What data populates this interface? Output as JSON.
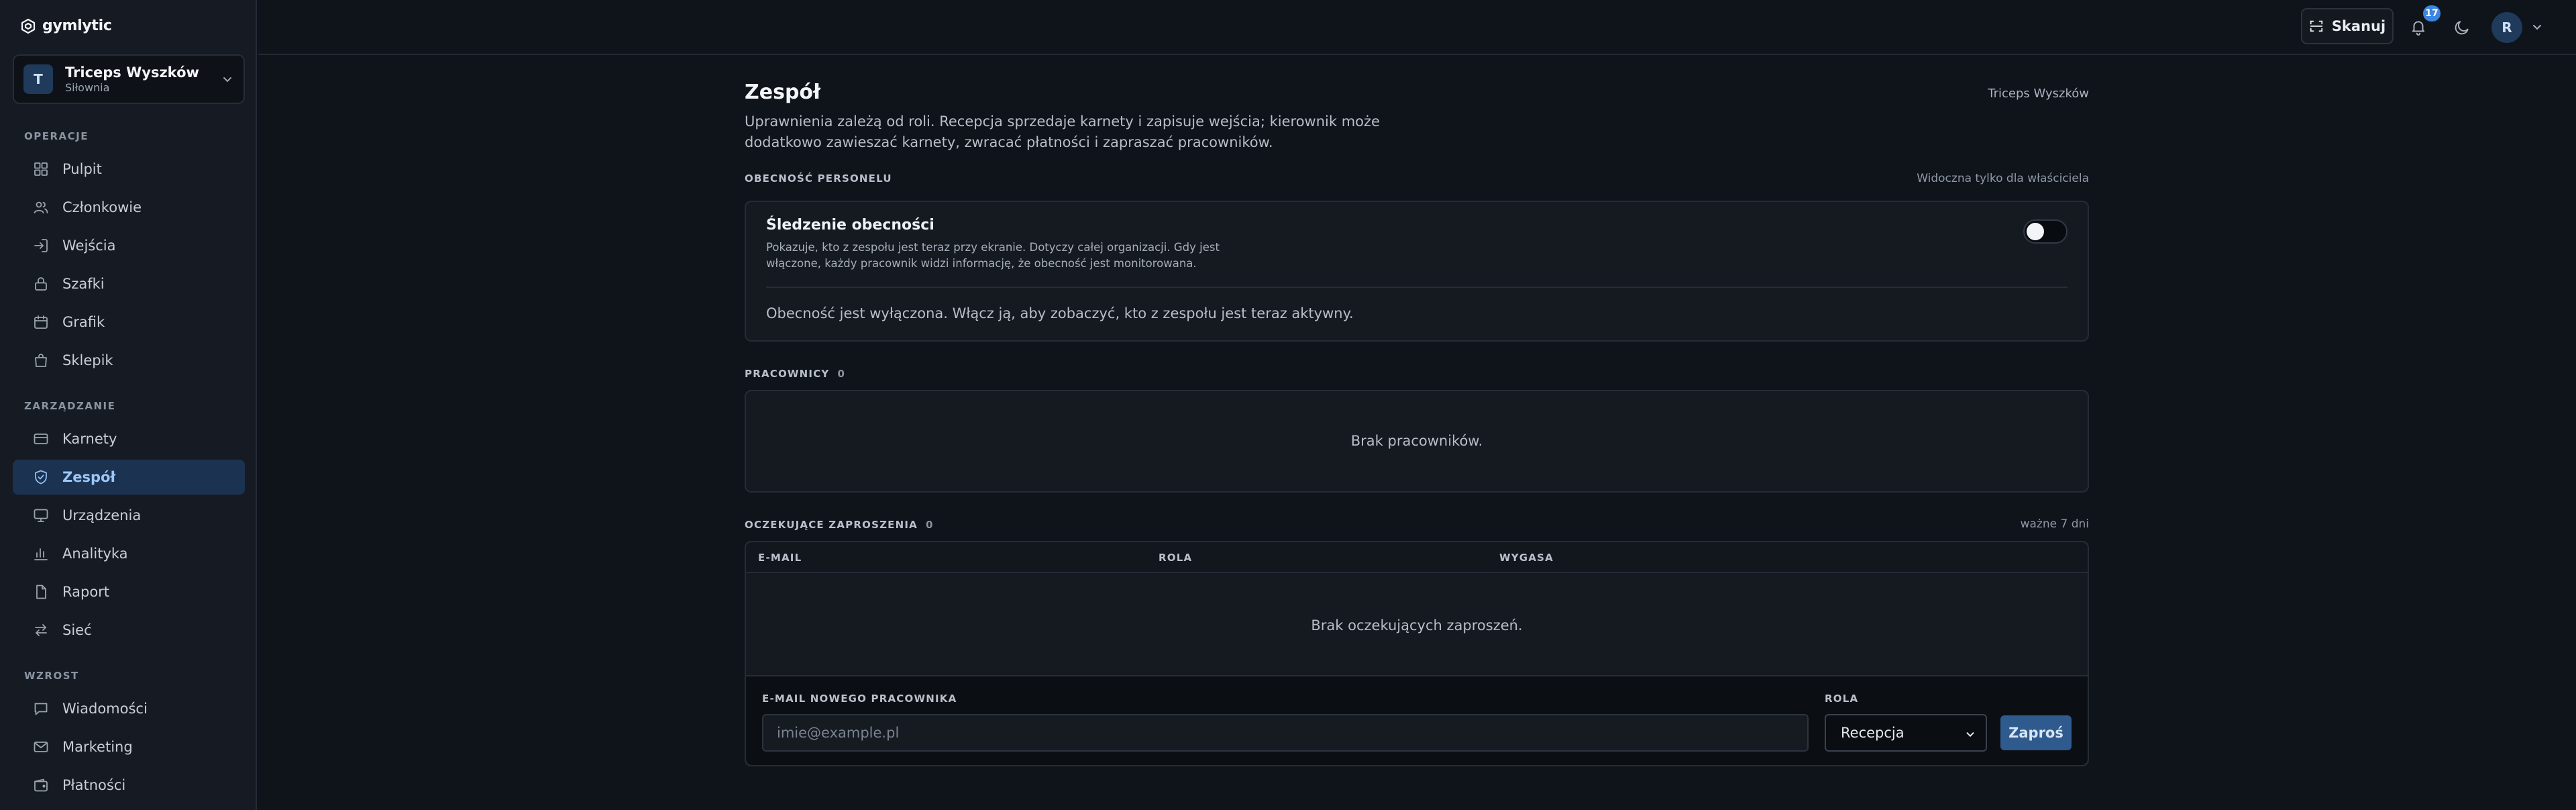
{
  "app": {
    "brand": "gymlytic"
  },
  "org": {
    "initial": "T",
    "name": "Triceps Wyszków",
    "type": "Siłownia"
  },
  "sidebar": {
    "sections": [
      {
        "label": "OPERACJE",
        "items": [
          {
            "label": "Pulpit",
            "icon": "grid-icon"
          },
          {
            "label": "Członkowie",
            "icon": "users-icon"
          },
          {
            "label": "Wejścia",
            "icon": "login-icon"
          },
          {
            "label": "Szafki",
            "icon": "lock-icon"
          },
          {
            "label": "Grafik",
            "icon": "calendar-icon"
          },
          {
            "label": "Sklepik",
            "icon": "shopping-bag-icon"
          }
        ]
      },
      {
        "label": "ZARZĄDZANIE",
        "items": [
          {
            "label": "Karnety",
            "icon": "card-icon"
          },
          {
            "label": "Zespół",
            "icon": "shield-icon",
            "active": true
          },
          {
            "label": "Urządzenia",
            "icon": "monitor-icon"
          },
          {
            "label": "Analityka",
            "icon": "bar-chart-icon"
          },
          {
            "label": "Raport",
            "icon": "document-icon"
          },
          {
            "label": "Sieć",
            "icon": "arrows-icon"
          }
        ]
      },
      {
        "label": "WZROST",
        "items": [
          {
            "label": "Wiadomości",
            "icon": "message-icon"
          },
          {
            "label": "Marketing",
            "icon": "mail-icon"
          },
          {
            "label": "Płatności",
            "icon": "wallet-icon"
          }
        ]
      }
    ]
  },
  "topbar": {
    "scan_label": "Skanuj",
    "notifications_count": "17",
    "user_initial": "R"
  },
  "page": {
    "title": "Zespół",
    "org_crumb": "Triceps Wyszków",
    "description": "Uprawnienia zależą od roli. Recepcja sprzedaje karnety i zapisuje wejścia; kierownik może dodatkowo zawieszać karnety, zwracać płatności i zapraszać pracowników."
  },
  "attendance": {
    "section_label": "OBECNOŚĆ PERSONELU",
    "section_note": "Widoczna tylko dla właściciela",
    "title": "Śledzenie obecności",
    "description": "Pokazuje, kto z zespołu jest teraz przy ekranie. Dotyczy całej organizacji. Gdy jest włączone, każdy pracownik widzi informację, że obecność jest monitorowana.",
    "enabled": false,
    "status_text": "Obecność jest wyłączona. Włącz ją, aby zobaczyć, kto z zespołu jest teraz aktywny."
  },
  "employees": {
    "section_label": "PRACOWNICY",
    "count": "0",
    "empty_text": "Brak pracowników."
  },
  "invitations": {
    "section_label": "OCZEKUJĄCE ZAPROSZENIA",
    "count": "0",
    "section_note": "ważne 7 dni",
    "columns": [
      "E-MAIL",
      "ROLA",
      "WYGASA"
    ],
    "empty_text": "Brak oczekujących zaproszeń.",
    "form": {
      "email_label": "E-MAIL NOWEGO PRACOWNIKA",
      "email_value": "",
      "email_placeholder": "imie@example.pl",
      "role_label": "ROLA",
      "role_value": "Recepcja",
      "submit_label": "Zaproś"
    }
  },
  "colors": {
    "accent": "#3b86e0",
    "active_nav_bg": "#1b3251",
    "button_bg": "#2e5a8e",
    "background": "#0f141b"
  }
}
